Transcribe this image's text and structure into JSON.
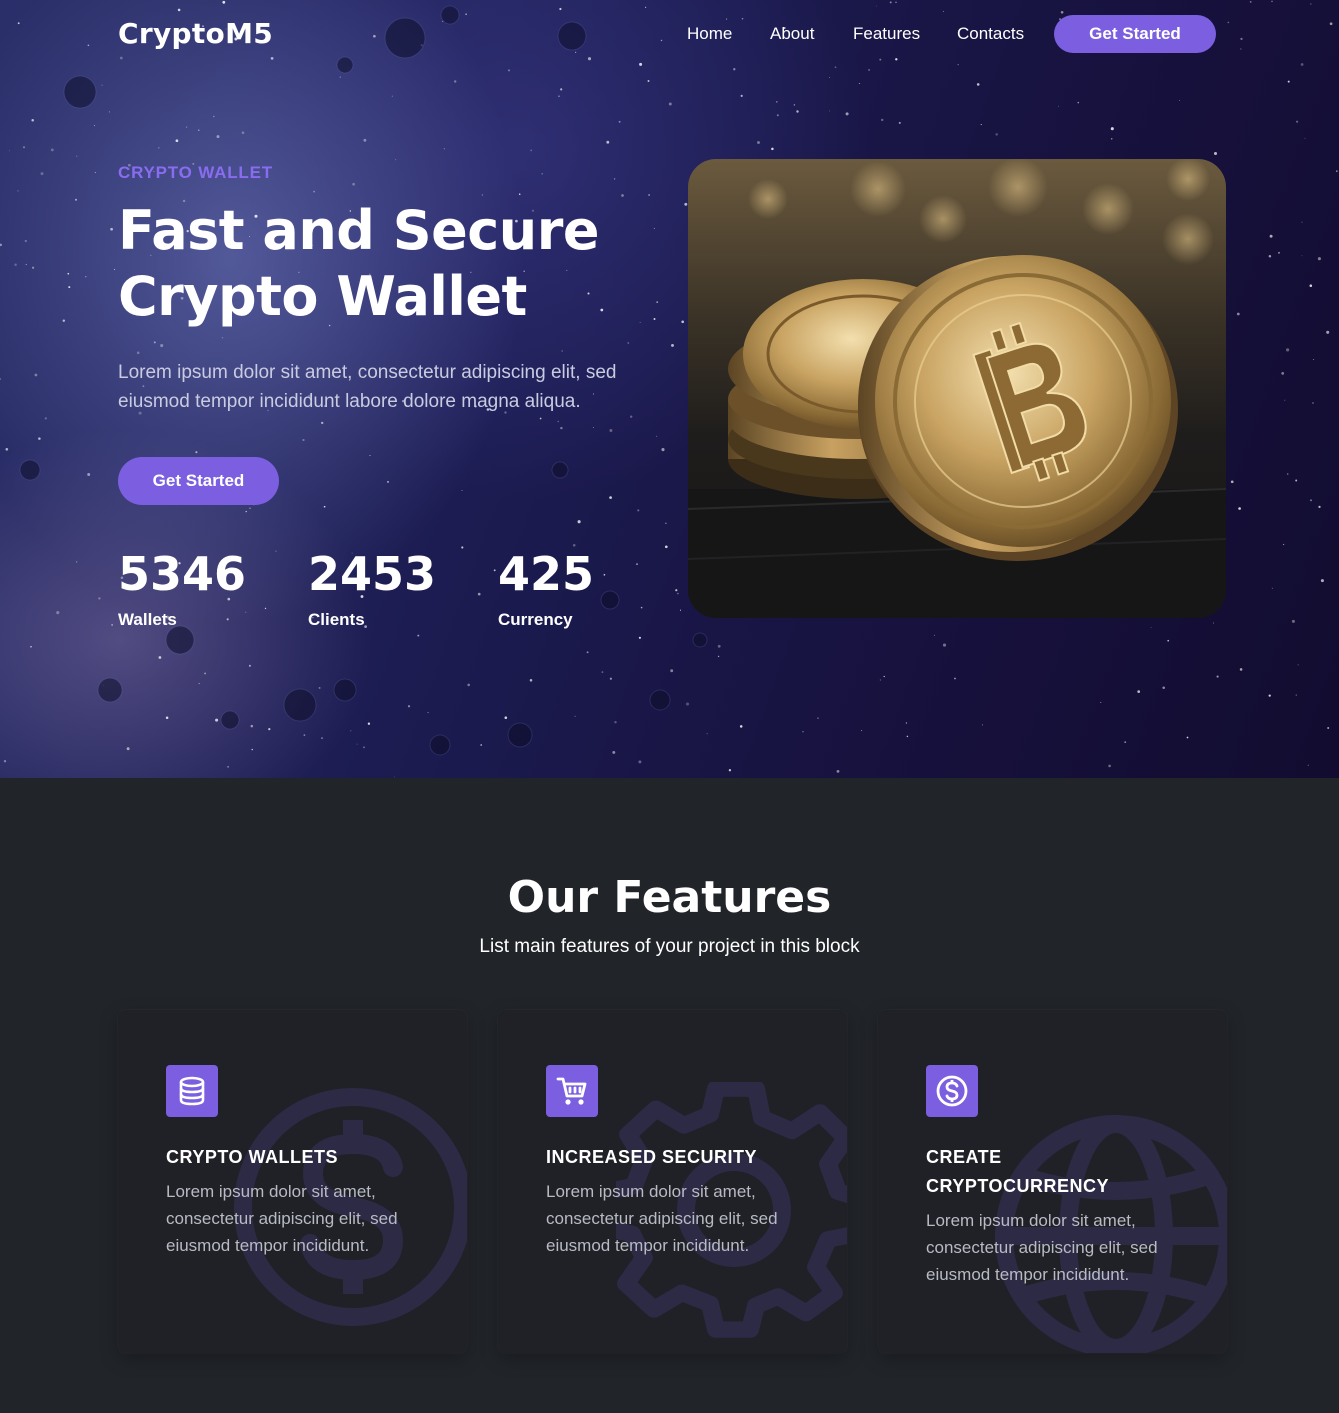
{
  "nav": {
    "logo": "CryptoM5",
    "links": [
      "Home",
      "About",
      "Features",
      "Contacts"
    ],
    "cta": "Get Started"
  },
  "hero": {
    "eyebrow": "CRYPTO WALLET",
    "title_line1": "Fast and Secure",
    "title_line2": "Crypto Wallet",
    "description": "Lorem ipsum dolor sit amet, consectetur adipiscing elit, sed eiusmod tempor incididunt labore dolore magna aliqua.",
    "cta": "Get Started",
    "stats": [
      {
        "value": "5346",
        "label": "Wallets"
      },
      {
        "value": "2453",
        "label": "Clients"
      },
      {
        "value": "425",
        "label": "Currency"
      }
    ],
    "image_icon": "bitcoin-coins-photo"
  },
  "features": {
    "title": "Our Features",
    "subtitle": "List main features of your project in this block",
    "cards": [
      {
        "title": "CRYPTO WALLETS",
        "text": "Lorem ipsum dolor sit amet, consectetur adipiscing elit, sed eiusmod tempor incididunt.",
        "icon": "database-icon",
        "bg_icon": "dollar-circle-icon"
      },
      {
        "title": "INCREASED SECURITY",
        "text": "Lorem ipsum dolor sit amet, consectetur adipiscing elit, sed eiusmod tempor incididunt.",
        "icon": "cart-icon",
        "bg_icon": "gear-icon"
      },
      {
        "title": "CREATE CRYPTOCURRENCY",
        "text": "Lorem ipsum dolor sit amet, consectetur adipiscing elit, sed eiusmod tempor incididunt.",
        "icon": "dollar-circle-icon",
        "bg_icon": "globe-icon"
      }
    ]
  },
  "colors": {
    "accent": "#7b5fe0",
    "eyebrow": "#8a6cf0",
    "section_bg": "#212429",
    "card_bg": "#1f2126"
  }
}
